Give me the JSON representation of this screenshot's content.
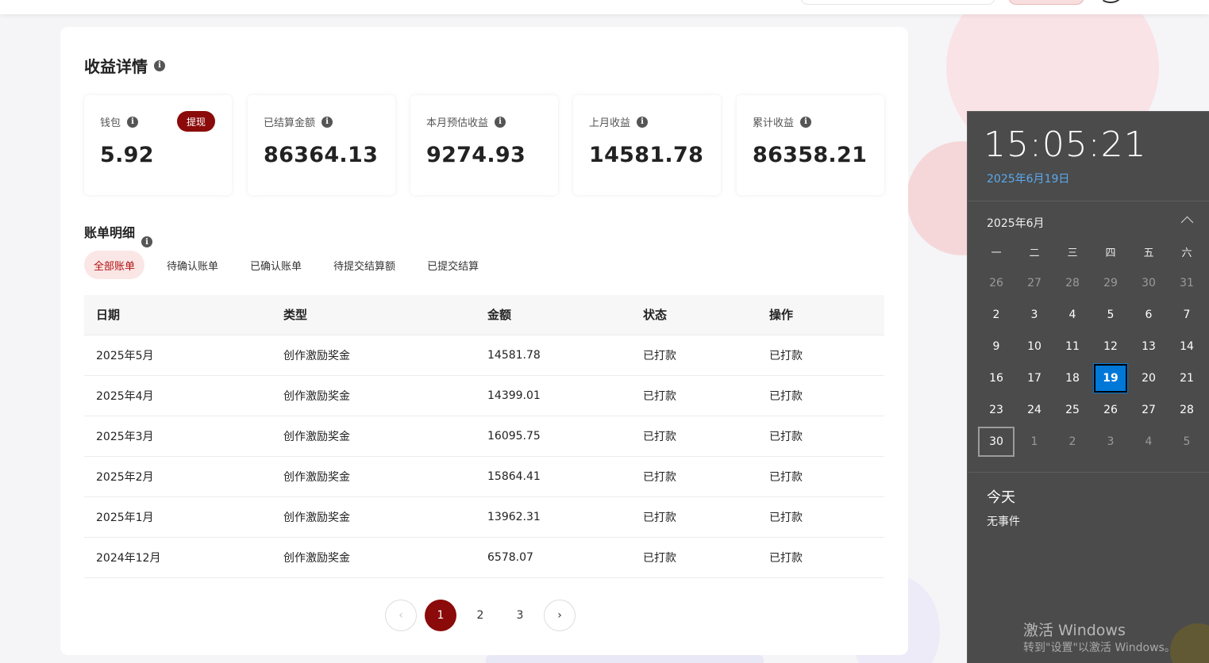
{
  "page": {
    "title": "收益详情",
    "stats": [
      {
        "label": "钱包",
        "value": "5.92",
        "action_label": "提现"
      },
      {
        "label": "已结算金额",
        "value": "86364.13"
      },
      {
        "label": "本月预估收益",
        "value": "9274.93"
      },
      {
        "label": "上月收益",
        "value": "14581.78"
      },
      {
        "label": "累计收益",
        "value": "86358.21"
      }
    ],
    "bills_title": "账单明细",
    "tabs": [
      "全部账单",
      "待确认账单",
      "已确认账单",
      "待提交结算额",
      "已提交结算"
    ],
    "active_tab": "全部账单",
    "table": {
      "headers": [
        "日期",
        "类型",
        "金额",
        "状态",
        "操作"
      ],
      "rows": [
        [
          "2025年5月",
          "创作激励奖金",
          "14581.78",
          "已打款",
          "已打款"
        ],
        [
          "2025年4月",
          "创作激励奖金",
          "14399.01",
          "已打款",
          "已打款"
        ],
        [
          "2025年3月",
          "创作激励奖金",
          "16095.75",
          "已打款",
          "已打款"
        ],
        [
          "2025年2月",
          "创作激励奖金",
          "15864.41",
          "已打款",
          "已打款"
        ],
        [
          "2025年1月",
          "创作激励奖金",
          "13962.31",
          "已打款",
          "已打款"
        ],
        [
          "2024年12月",
          "创作激励奖金",
          "6578.07",
          "已打款",
          "已打款"
        ]
      ]
    },
    "pagination": {
      "pages": [
        "1",
        "2",
        "3"
      ],
      "current": "1",
      "prev": "‹",
      "next": "›"
    }
  },
  "flyout": {
    "time": "15:05:21",
    "date": "2025年6月19日",
    "month": "2025年6月",
    "weekdays": [
      "一",
      "二",
      "三",
      "四",
      "五",
      "六"
    ],
    "weeks": [
      [
        "26",
        "27",
        "28",
        "29",
        "30",
        "31"
      ],
      [
        "2",
        "3",
        "4",
        "5",
        "6",
        "7"
      ],
      [
        "9",
        "10",
        "11",
        "12",
        "13",
        "14"
      ],
      [
        "16",
        "17",
        "18",
        "19",
        "20",
        "21"
      ],
      [
        "23",
        "24",
        "25",
        "26",
        "27",
        "28"
      ],
      [
        "30",
        "1",
        "2",
        "3",
        "4",
        "5"
      ]
    ],
    "today": "19",
    "events_title": "今天",
    "events_empty": "无事件"
  },
  "watermark": {
    "line1": "激活 Windows",
    "line2": "转到\"设置\"以激活 Windows。"
  },
  "colors": {
    "brand": "#8b0a0a",
    "success": "#3b9a2e",
    "calendar_today": "#0078d7",
    "calendar_bg": "#4b4b4b"
  }
}
